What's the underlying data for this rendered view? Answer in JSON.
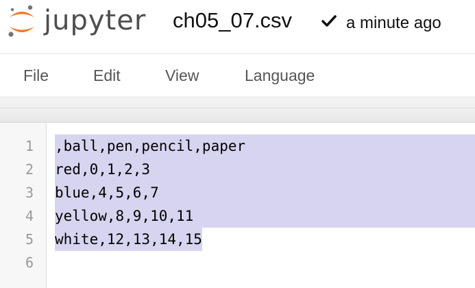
{
  "header": {
    "logo_text": "jupyter",
    "file_name": "ch05_07.csv",
    "save_status": "a minute ago",
    "icons": {
      "logo": "jupyter-logo-icon",
      "saved": "checkmark-icon"
    },
    "colors": {
      "logo_orange": "#f37726",
      "logo_gray": "#767677"
    }
  },
  "menubar": {
    "items": [
      {
        "label": "File"
      },
      {
        "label": "Edit"
      },
      {
        "label": "View"
      },
      {
        "label": "Language"
      }
    ]
  },
  "editor": {
    "line_numbers": [
      "1",
      "2",
      "3",
      "4",
      "5",
      "6"
    ],
    "lines": [
      ",ball,pen,pencil,paper",
      "red,0,1,2,3",
      "blue,4,5,6,7",
      "yellow,8,9,10,11",
      "white,12,13,14,15",
      ""
    ],
    "selection_color": "#d7d4f0"
  }
}
